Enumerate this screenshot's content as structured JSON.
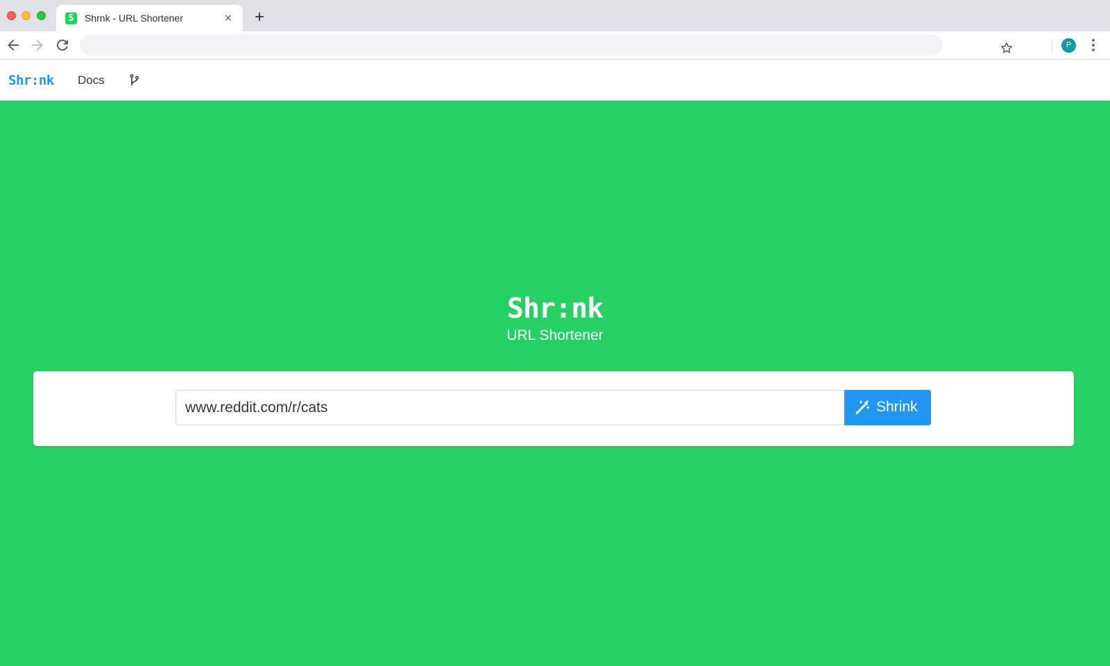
{
  "browser": {
    "tab": {
      "favicon_letter": "S",
      "title": "Shrnk - URL Shortener",
      "close_glyph": "×"
    },
    "new_tab_glyph": "+",
    "address_bar": {
      "value": ""
    },
    "profile_initial": "P",
    "icons": [
      "back-arrow-icon",
      "forward-arrow-icon",
      "reload-icon",
      "star-icon",
      "kebab-menu-icon"
    ]
  },
  "site_nav": {
    "brand": "Shr:nk",
    "links": [
      {
        "label": "Docs"
      }
    ],
    "git_icon": "git-branch-icon"
  },
  "hero": {
    "title": "Shr:nk",
    "subtitle": "URL Shortener",
    "background_color": "#26d062"
  },
  "shortener_form": {
    "url_value": "www.reddit.com/r/cats",
    "button_label": "Shrink",
    "button_icon": "magic-wand-icon",
    "button_color": "#2196f3"
  }
}
